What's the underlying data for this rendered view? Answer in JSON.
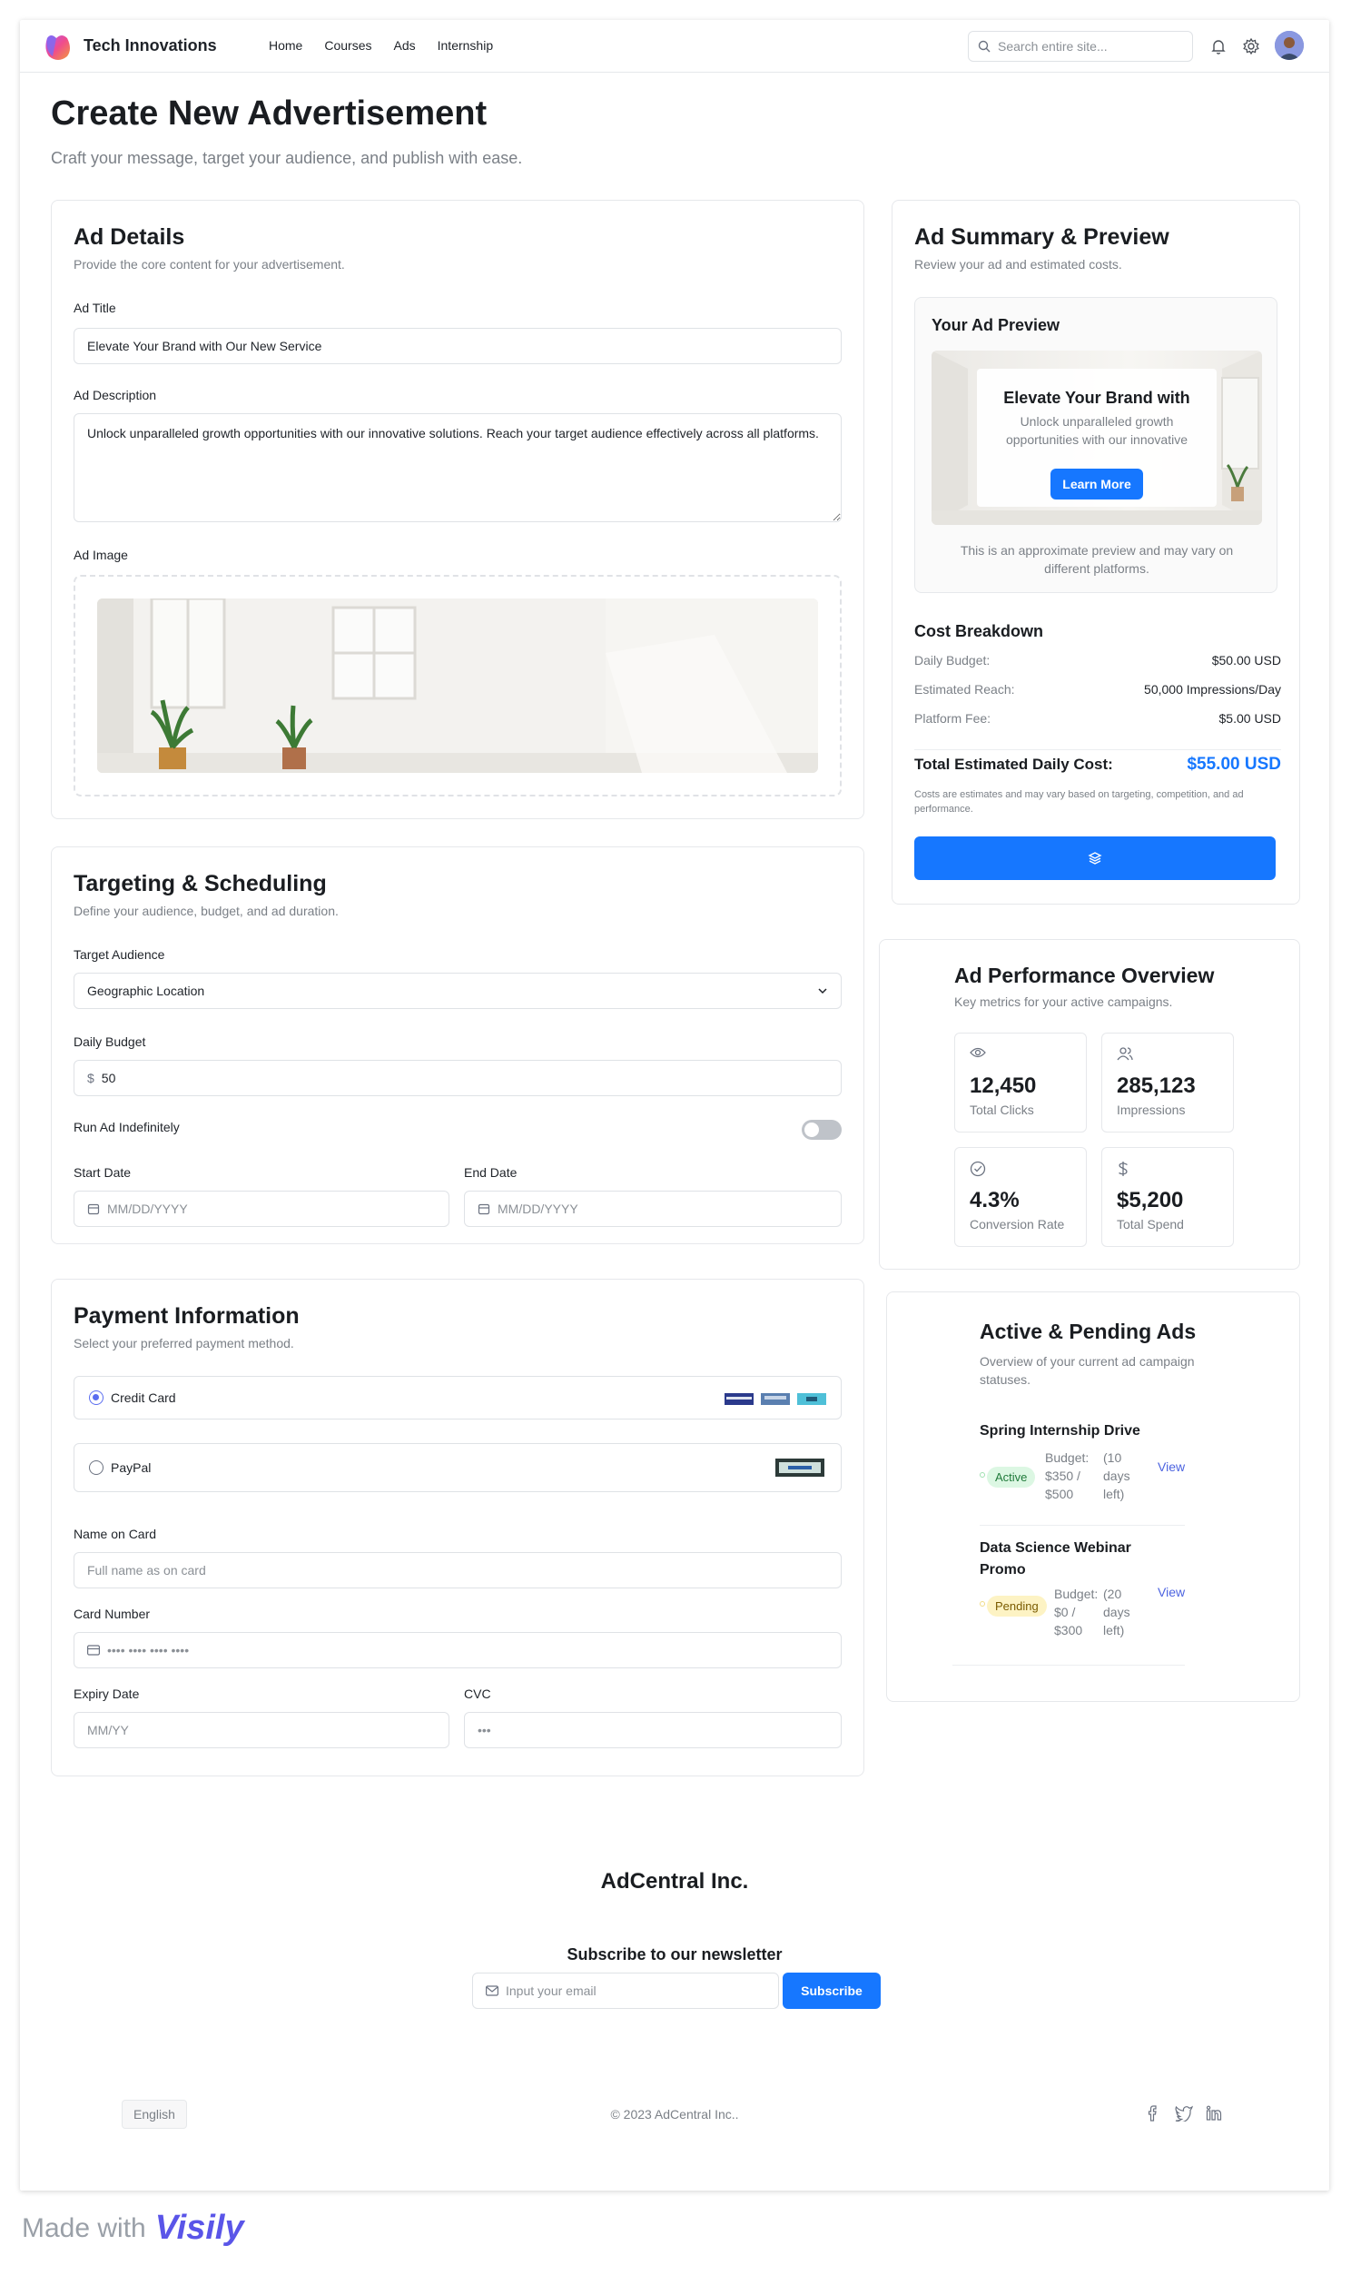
{
  "header": {
    "brand": "Tech Innovations",
    "nav": [
      "Home",
      "Courses",
      "Ads",
      "Internship"
    ],
    "search_placeholder": "Search entire site..."
  },
  "page": {
    "title": "Create New Advertisement",
    "subtitle": "Craft your message, target your audience, and publish with ease."
  },
  "ad_details": {
    "title": "Ad Details",
    "subtitle": "Provide the core content for your advertisement.",
    "ad_title_label": "Ad Title",
    "ad_title_value": "Elevate Your Brand with Our New Service",
    "description_label": "Ad Description",
    "description_value": "Unlock unparalleled growth opportunities with our innovative solutions. Reach your target audience effectively across all platforms.",
    "image_label": "Ad Image"
  },
  "targeting": {
    "title": "Targeting & Scheduling",
    "subtitle": "Define your audience, budget, and ad duration.",
    "audience_label": "Target Audience",
    "audience_value": "Geographic Location",
    "budget_label": "Daily Budget",
    "budget_currency": "$",
    "budget_value": "50",
    "indefinite_label": "Run Ad Indefinitely",
    "indefinite_on": false,
    "start_label": "Start Date",
    "start_placeholder": "MM/DD/YYYY",
    "end_label": "End Date",
    "end_placeholder": "MM/DD/YYYY"
  },
  "payment": {
    "title": "Payment Information",
    "subtitle": "Select your preferred payment method.",
    "option_card": "Credit Card",
    "option_paypal": "PayPal",
    "name_label": "Name on Card",
    "name_placeholder": "Full name as on card",
    "number_label": "Card Number",
    "number_placeholder": "•••• •••• •••• ••••",
    "expiry_label": "Expiry Date",
    "expiry_placeholder": "MM/YY",
    "cvc_label": "CVC",
    "cvc_placeholder": "•••"
  },
  "summary": {
    "title": "Ad Summary & Preview",
    "subtitle": "Review your ad and estimated costs.",
    "preview_title": "Your Ad Preview",
    "preview_headline": "Elevate Your Brand with",
    "preview_body": "Unlock unparalleled growth opportunities with our innovative",
    "preview_cta": "Learn More",
    "preview_note": "This is an approximate preview and may vary on different platforms.",
    "cost_title": "Cost Breakdown",
    "rows": [
      {
        "k": "Daily Budget:",
        "v": "$50.00 USD"
      },
      {
        "k": "Estimated Reach:",
        "v": "50,000 Impressions/Day"
      },
      {
        "k": "Platform Fee:",
        "v": "$5.00 USD"
      }
    ],
    "total_label": "Total Estimated Daily Cost:",
    "total_value": "$55.00 USD",
    "disclaimer": "Costs are estimates and may vary based on targeting, competition, and ad performance."
  },
  "performance": {
    "title": "Ad Performance Overview",
    "subtitle": "Key metrics for your active campaigns.",
    "metrics": [
      {
        "value": "12,450",
        "label": "Total Clicks",
        "icon": "eye-icon"
      },
      {
        "value": "285,123",
        "label": "Impressions",
        "icon": "users-icon"
      },
      {
        "value": "4.3%",
        "label": "Conversion Rate",
        "icon": "check-circle-icon"
      },
      {
        "value": "$5,200",
        "label": "Total Spend",
        "icon": "dollar-icon"
      }
    ]
  },
  "active_ads": {
    "title": "Active & Pending Ads",
    "subtitle": "Overview of your current ad campaign statuses.",
    "items": [
      {
        "name": "Spring Internship Drive",
        "status": "Active",
        "budget": "Budget: $350 / $500",
        "days": "(10 days left)",
        "link": "View"
      },
      {
        "name": "Data Science Webinar Promo",
        "status": "Pending",
        "budget": "Budget: $0 / $300",
        "days": "(20 days left)",
        "link": "View"
      }
    ]
  },
  "footer": {
    "brand": "AdCentral Inc.",
    "newsletter_title": "Subscribe to our newsletter",
    "email_placeholder": "Input your email",
    "subscribe": "Subscribe",
    "language": "English",
    "copyright": "© 2023 AdCentral Inc.."
  },
  "watermark": {
    "prefix": "Made with",
    "brand": "Visily"
  },
  "colors": {
    "primary": "#1677ff",
    "accent": "#5b6ef0",
    "active": "#dcf7e3",
    "pending": "#fdf3c4"
  }
}
